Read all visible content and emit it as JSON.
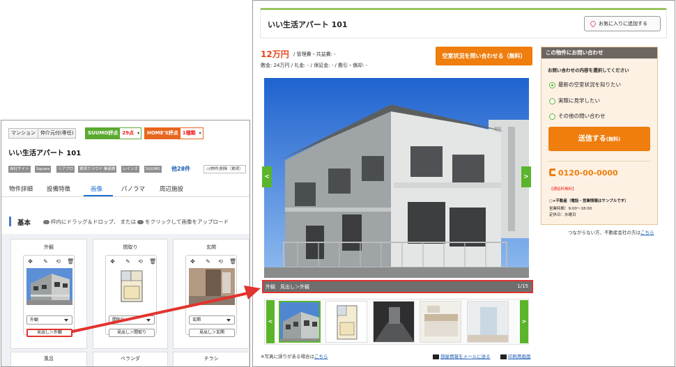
{
  "admin": {
    "chips": [
      "マンション",
      "仲介元付(専任)"
    ],
    "suumo": {
      "label": "SUUMO評点",
      "value": "29点"
    },
    "homes": {
      "label": "HOME'S評点",
      "value": "1種類"
    },
    "title": "いい生活アパート 101",
    "tags": [
      "自社サイト",
      "Square",
      "リアプロ",
      "賃貸クラウド 業者間",
      "レインズ",
      "SUUMO"
    ],
    "more": "他28件",
    "memo": "[物件]削除（賃貸）",
    "tabs": [
      "物件詳細",
      "設備特徴",
      "画像",
      "パノラマ",
      "周辺施設"
    ],
    "active_tab": "画像",
    "section_title": "基本",
    "section_help_1": "枠内にドラッグ＆ドロップ、 または",
    "section_help_2": "をクリックして画像をアップロード",
    "cards": [
      {
        "label": "外観",
        "select": "外観",
        "heading": "見出し＞外観"
      },
      {
        "label": "間取り",
        "select": "間取り",
        "heading": "見出し＞間取り"
      },
      {
        "label": "玄関",
        "select": "玄関",
        "heading": "見出し＞玄関"
      }
    ],
    "bottom_cards": [
      "風呂",
      "ベランダ",
      "チラシ"
    ],
    "tool_icons": [
      "move-icon",
      "edit-icon",
      "rotate-icon",
      "trash-icon"
    ]
  },
  "site": {
    "title": "いい生活アパート 101",
    "favorite": "お気に入りに追加する",
    "price": "12万円",
    "price_sub": "/ 管理費・共益費: -",
    "deposit": "敷金: 24万円 / 礼金: - / 保証金: - / 敷引・償却: -",
    "vacancy_button": "空室状況を問い合わせる（無料）",
    "caption": "外観　見出し＞外観",
    "page_counter": "1/15",
    "footnote_prefix": "※写真に誤りがある場合は",
    "footnote_link": "こちら",
    "mail_link": "部屋情報をメールに送る",
    "print_link": "印刷用画面"
  },
  "inquiry": {
    "header": "この物件にお問い合わせ",
    "prompt": "お問い合わせの内容を選択してください",
    "options": [
      "最新の空室状況を知りたい",
      "実際に見学したい",
      "その他の問い合わせ"
    ],
    "selected": 0,
    "send_main": "送信する",
    "send_sub": "(無料)",
    "phone": "0120-00-0000",
    "free_call": "【通話料無料】",
    "company": "○×不動産（電話・営業情報はサンプルです）",
    "hours": "営業時間：9:00～18:00",
    "holiday": "定休日：水曜日",
    "notfound_prefix": "つながらない方、不動産会社の方は",
    "notfound_link": "こちら"
  },
  "colors": {
    "accent_green": "#5ab52b",
    "accent_orange": "#ef7e0f",
    "price_red": "#e8461e",
    "highlight_red": "#e2332d",
    "link_blue": "#1d5cb4"
  }
}
